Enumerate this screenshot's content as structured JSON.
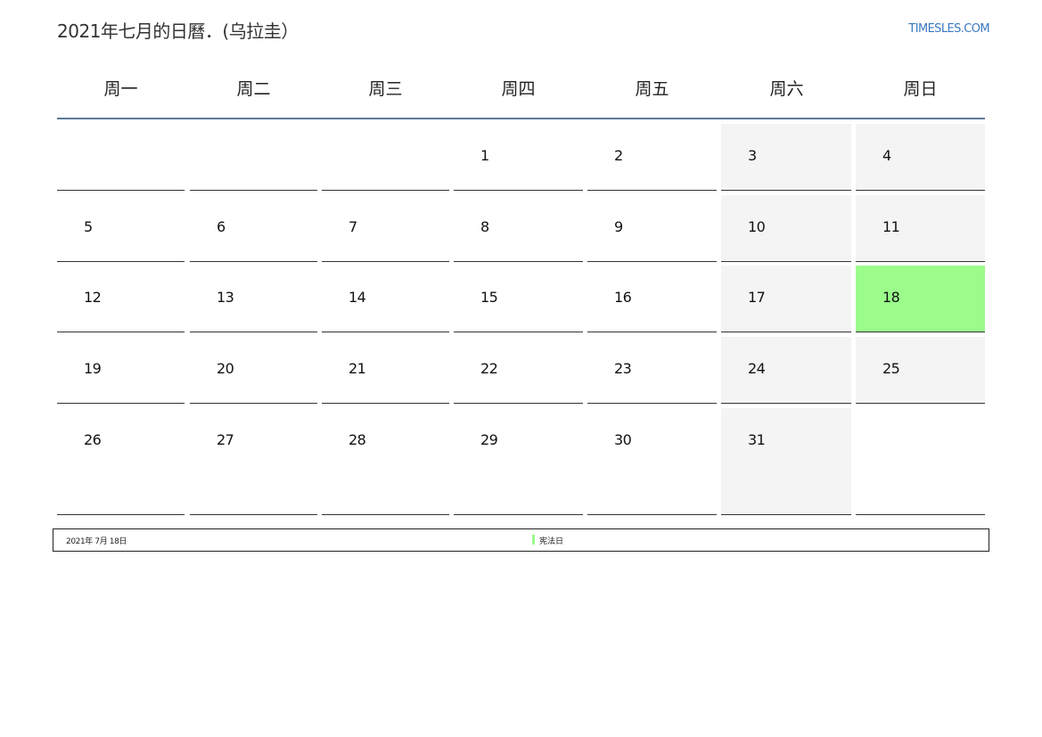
{
  "header": {
    "title": "2021年七月的日曆．(乌拉圭）",
    "site": "TIMESLES.COM"
  },
  "weekdays": [
    "周一",
    "周二",
    "周三",
    "周四",
    "周五",
    "周六",
    "周日"
  ],
  "weeks": [
    [
      "",
      "",
      "",
      "1",
      "2",
      "3",
      "4"
    ],
    [
      "5",
      "6",
      "7",
      "8",
      "9",
      "10",
      "11"
    ],
    [
      "12",
      "13",
      "14",
      "15",
      "16",
      "17",
      "18"
    ],
    [
      "19",
      "20",
      "21",
      "22",
      "23",
      "24",
      "25"
    ],
    [
      "26",
      "27",
      "28",
      "29",
      "30",
      "31",
      ""
    ]
  ],
  "holiday": {
    "date_label": "2021年 7月 18日",
    "name": "宪法日",
    "day": "18"
  },
  "colors": {
    "holiday": "#9bfc8b",
    "weekend": "#f4f4f4",
    "header_rule": "#5b7a99",
    "link": "#3a78c0"
  }
}
